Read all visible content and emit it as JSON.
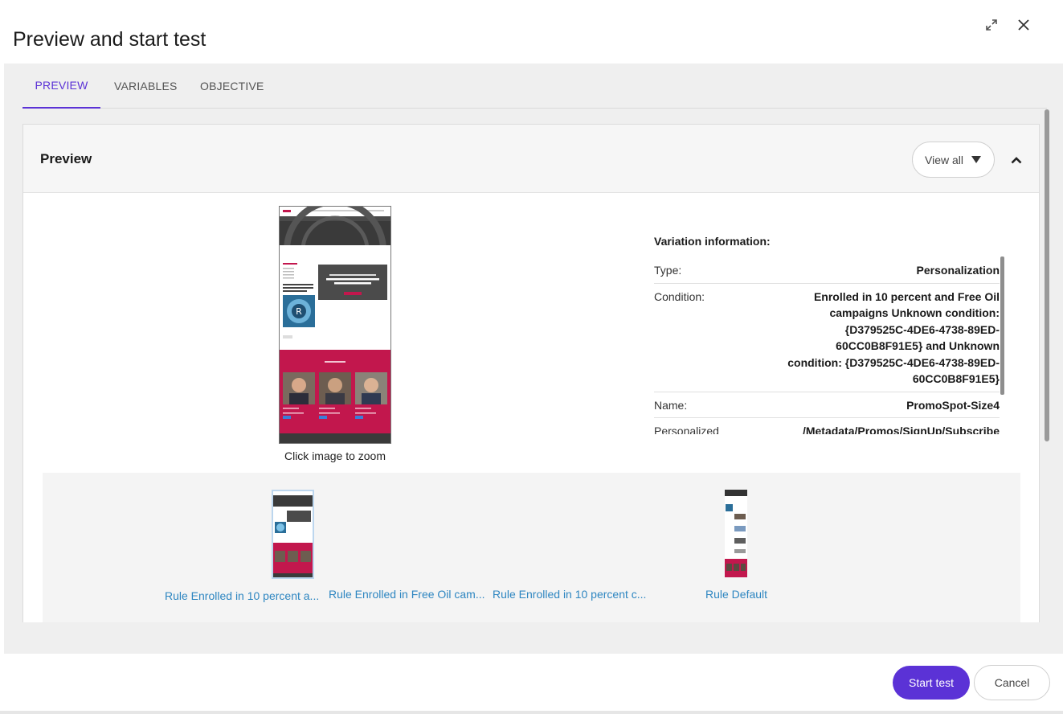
{
  "dialog": {
    "title": "Preview and start test"
  },
  "icons": {
    "expand": "expand-arrows-icon",
    "close": "close-icon",
    "collapse": "chevron-up-icon",
    "view_all_caret": "caret-down-icon"
  },
  "tabs": [
    {
      "label": "PREVIEW",
      "active": true
    },
    {
      "label": "VARIABLES",
      "active": false
    },
    {
      "label": "OBJECTIVE",
      "active": false
    }
  ],
  "preview": {
    "title": "Preview",
    "view_all_label": "View all",
    "zoom_caption": "Click image to zoom"
  },
  "variation": {
    "title": "Variation information:",
    "rows": [
      {
        "key": "Type:",
        "value": "Personalization"
      },
      {
        "key": "Condition:",
        "value": "Enrolled in 10 percent and Free Oil campaigns Unknown condition: {D379525C-4DE6-4738-89ED-60CC0B8F91E5} and Unknown condition: {D379525C-4DE6-4738-89ED-60CC0B8F91E5}"
      },
      {
        "key": "Name:",
        "value": "PromoSpot-Size4"
      },
      {
        "key": "Personalized",
        "value": "/Metadata/Promos/SignUp/Subscribe"
      }
    ]
  },
  "thumbnails": [
    {
      "label": "Rule Enrolled in 10 percent a..."
    },
    {
      "label": "Rule Enrolled in Free Oil cam..."
    },
    {
      "label": "Rule Enrolled in 10 percent c..."
    },
    {
      "label": "Rule Default"
    }
  ],
  "footer": {
    "start_label": "Start test",
    "cancel_label": "Cancel"
  },
  "colors": {
    "accent": "#5b32d6",
    "link": "#2e86c1",
    "promo": "#c2174d"
  }
}
